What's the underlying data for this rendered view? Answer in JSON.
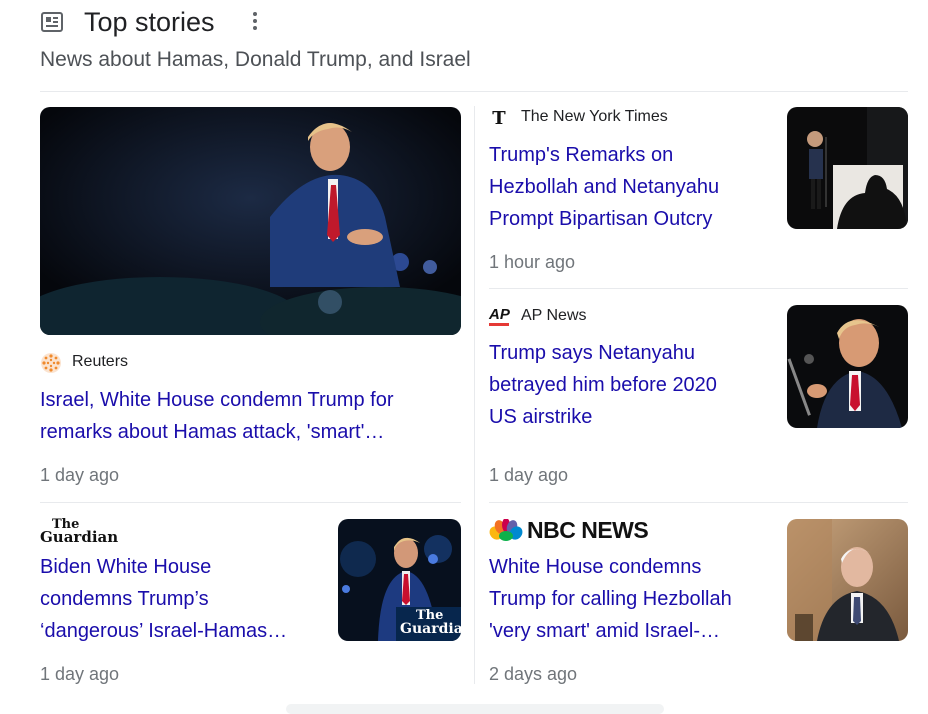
{
  "header": {
    "title": "Top stories",
    "subtitle": "News about Hamas, Donald Trump, and Israel",
    "icon": "news-icon"
  },
  "stories": [
    {
      "source": "Reuters",
      "headline_line1": "Israel, White House condemn Trump for",
      "headline_line2": "remarks about Hamas attack, 'smart'…",
      "time": "1 day ago"
    },
    {
      "source": "The New York Times",
      "headline_line1": "Trump's Remarks on",
      "headline_line2": "Hezbollah and Netanyahu",
      "headline_line3": "Prompt Bipartisan Outcry",
      "time": "1 hour ago"
    },
    {
      "source": "AP News",
      "logo_text": "AP",
      "headline_line1": "Trump says Netanyahu",
      "headline_line2": "betrayed him before 2020",
      "headline_line3": "US airstrike",
      "time": "1 day ago"
    },
    {
      "source_logo_line1": "The",
      "source_logo_line2": "Guardian",
      "headline_line1": "Biden White House",
      "headline_line2": "condemns Trump’s",
      "headline_line3": "‘dangerous’ Israel-Hamas…",
      "time": "1 day ago",
      "thumb_watermark_line1": "The",
      "thumb_watermark_line2": "Guardian"
    },
    {
      "source_logo_text": "NBC NEWS",
      "headline_line1": "White House condemns",
      "headline_line2": "Trump for calling Hezbollah",
      "headline_line3": "'very smart' amid Israel-…",
      "time": "2 days ago"
    }
  ],
  "colors": {
    "link": "#1a0dab",
    "meta": "#70757a",
    "divider": "#e8eaed"
  }
}
